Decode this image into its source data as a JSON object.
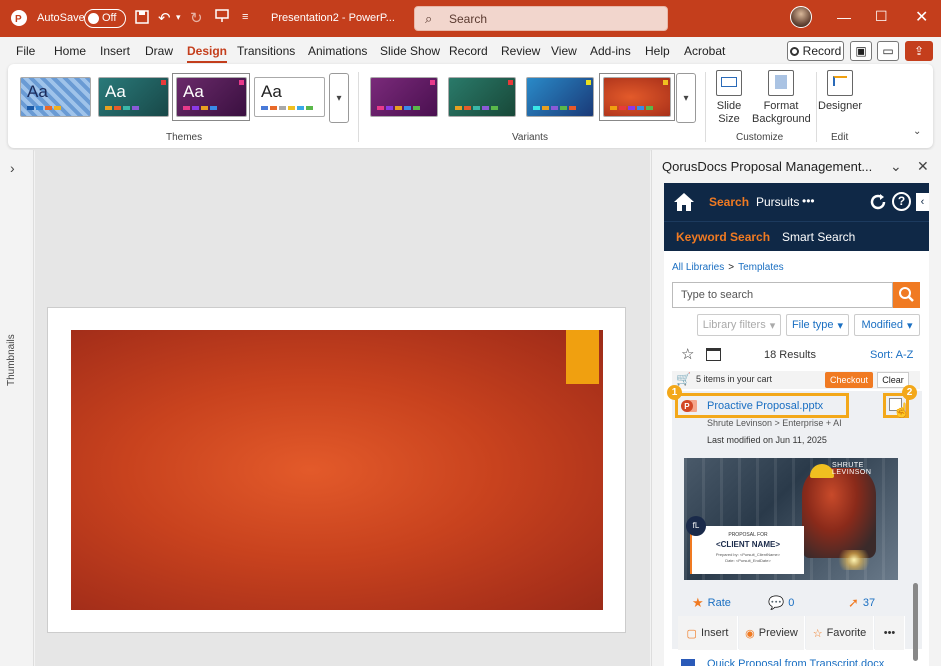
{
  "titlebar": {
    "autosave_label": "AutoSave",
    "autosave_state": "Off",
    "doc_title": "Presentation2 - PowerP...",
    "search_placeholder": "Search"
  },
  "tabs": [
    "File",
    "Home",
    "Insert",
    "Draw",
    "Design",
    "Transitions",
    "Animations",
    "Slide Show",
    "Record",
    "Review",
    "View",
    "Add-ins",
    "Help",
    "Acrobat"
  ],
  "active_tab": "Design",
  "record_label": "Record",
  "ribbon": {
    "themes_label": "Themes",
    "variants_label": "Variants",
    "customize_label": "Customize",
    "edit_label": "Edit",
    "slide_size_label": "Slide Size",
    "format_bg_label": "Format Background",
    "designer_label": "Designer",
    "theme_aa": "Aa",
    "accent_colors": [
      "#c43e1c",
      "#1e8a7a",
      "#8a2a6a",
      "#2a7ab8",
      "#e35a2a"
    ]
  },
  "left_strip": {
    "label": "Thumbnails"
  },
  "pane": {
    "title": "QorusDocs Proposal Management...",
    "nav": {
      "search": "Search",
      "pursuits": "Pursuits",
      "more": "•••"
    },
    "subnav": {
      "keyword": "Keyword Search",
      "smart": "Smart Search"
    },
    "breadcrumb_root": "All Libraries",
    "breadcrumb_sep": ">",
    "breadcrumb_leaf": "Templates",
    "search_placeholder": "Type to search",
    "filters": {
      "library": "Library filters",
      "filetype": "File type",
      "modified": "Modified"
    },
    "results_count": "18 Results",
    "sort_label": "Sort: A-Z",
    "cart_text": "5 items in your cart",
    "checkout_label": "Checkout",
    "clear_label": "Clear",
    "callouts": [
      "1",
      "2"
    ],
    "result": {
      "title": "Proactive Proposal.pptx",
      "path": "Shrute Levinson > Enterprise + AI",
      "modified": "Last modified on  Jun 11, 2025"
    },
    "preview": {
      "watermark": "SHRUTE LEVINSON",
      "line1": "PROPOSAL FOR",
      "line2": "<CLIENT NAME>",
      "line3": "Prepared by: <Pursuit_ClientName>",
      "line4": "Date: <Pursuit_EndDate>"
    },
    "rate_label": "Rate",
    "comments_count": "0",
    "likes_count": "37",
    "insert_label": "Insert",
    "preview_label": "Preview",
    "favorite_label": "Favorite",
    "next_result": "Quick Proposal from Transcript.docx"
  }
}
